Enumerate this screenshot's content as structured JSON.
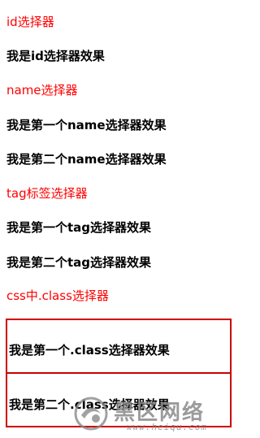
{
  "lines": {
    "id_selector": "id选择器",
    "id_effect": "我是id选择器效果",
    "name_selector": "name选择器",
    "name_effect_1": "我是第一个name选择器效果",
    "name_effect_2": "我是第二个name选择器效果",
    "tag_selector": "tag标签选择器",
    "tag_effect_1": "我是第一个tag选择器效果",
    "tag_effect_2": "我是第二个tag选择器效果",
    "class_selector": "css中.class选择器",
    "class_effect_1": "我是第一个.class选择器效果",
    "class_effect_2": "我是第二个.class选择器效果"
  },
  "watermark": {
    "title": "黑区网络",
    "url": "www.heiqu.com"
  },
  "colors": {
    "heading_red": "#ff0000",
    "box_border": "#cc0000",
    "watermark_gray": "#8a8a8a"
  }
}
